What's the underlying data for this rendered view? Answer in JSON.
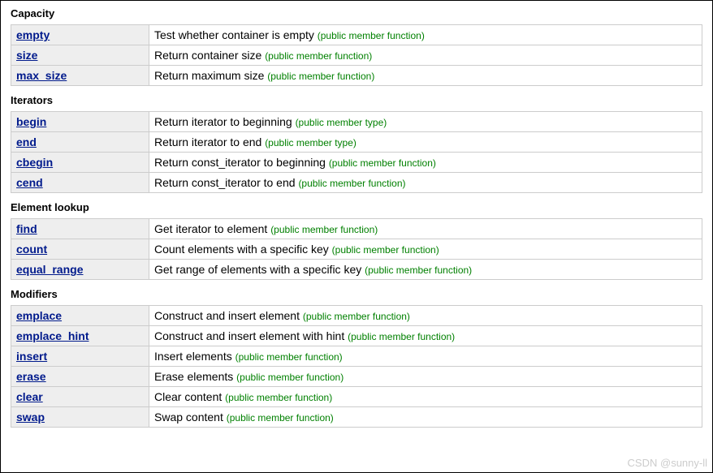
{
  "sections": [
    {
      "title": "Capacity",
      "rows": [
        {
          "name": "empty",
          "desc": "Test whether container is empty",
          "tag": "(public member function)"
        },
        {
          "name": "size",
          "desc": "Return container size",
          "tag": "(public member function)"
        },
        {
          "name": "max_size",
          "desc": "Return maximum size",
          "tag": "(public member function)"
        }
      ]
    },
    {
      "title": "Iterators",
      "rows": [
        {
          "name": "begin",
          "desc": "Return iterator to beginning",
          "tag": "(public member type)"
        },
        {
          "name": "end",
          "desc": "Return iterator to end",
          "tag": "(public member type)"
        },
        {
          "name": "cbegin",
          "desc": "Return const_iterator to beginning",
          "tag": "(public member function)"
        },
        {
          "name": "cend",
          "desc": "Return const_iterator to end",
          "tag": "(public member function)"
        }
      ]
    },
    {
      "title": "Element lookup",
      "rows": [
        {
          "name": "find",
          "desc": "Get iterator to element",
          "tag": "(public member function)"
        },
        {
          "name": "count",
          "desc": "Count elements with a specific key",
          "tag": "(public member function)"
        },
        {
          "name": "equal_range",
          "desc": "Get range of elements with a specific key",
          "tag": "(public member function)"
        }
      ]
    },
    {
      "title": "Modifiers",
      "rows": [
        {
          "name": "emplace",
          "desc": "Construct and insert element",
          "tag": "(public member function)"
        },
        {
          "name": "emplace_hint",
          "desc": "Construct and insert element with hint",
          "tag": "(public member function)"
        },
        {
          "name": "insert",
          "desc": "Insert elements",
          "tag": "(public member function)"
        },
        {
          "name": "erase",
          "desc": "Erase elements",
          "tag": "(public member function)"
        },
        {
          "name": "clear",
          "desc": "Clear content",
          "tag": "(public member function)"
        },
        {
          "name": "swap",
          "desc": "Swap content",
          "tag": "(public member function)"
        }
      ]
    }
  ],
  "watermark": "CSDN @sunny-ll"
}
